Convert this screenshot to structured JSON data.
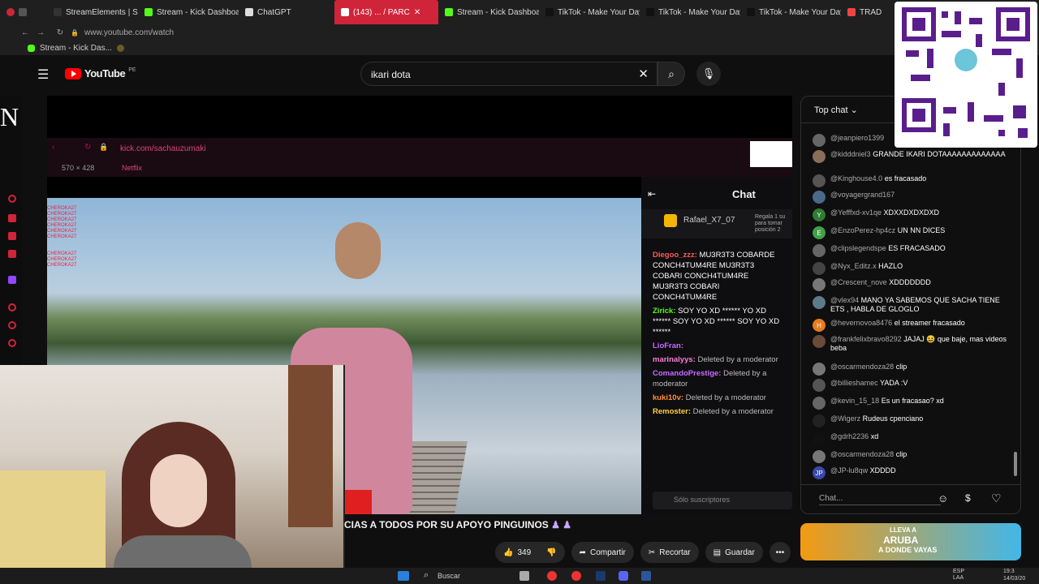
{
  "browser": {
    "tabs": [
      {
        "label": "StreamElements | Subati",
        "color": "#333"
      },
      {
        "label": "Stream - Kick Dashboard",
        "color": "#53fc18"
      },
      {
        "label": "ChatGPT",
        "color": "#ddd"
      },
      {
        "label": "(143) ... / PARC",
        "color": "#fff",
        "active": true
      },
      {
        "label": "Stream - Kick Dashboard",
        "color": "#53fc18"
      },
      {
        "label": "TikTok - Make Your Day",
        "color": "#111"
      },
      {
        "label": "TikTok - Make Your Day",
        "color": "#111"
      },
      {
        "label": "TikTok - Make Your Day",
        "color": "#111"
      },
      {
        "label": "TRADU",
        "color": "#e44"
      }
    ],
    "url": "www.youtube.com/watch",
    "bookmark": "Stream - Kick Das..."
  },
  "youtube": {
    "logo": "YouTube",
    "region": "PE",
    "search_value": "ikari dota",
    "video_title": "CIAS A TODOS POR SU APOYO PINGUINOS",
    "likes": "349",
    "share": "Compartir",
    "clip": "Recortar",
    "save": "Guardar",
    "more": "•••"
  },
  "left_letter": "N",
  "inner_browser": {
    "url": "kick.com/sachauzumaki",
    "size": "570 × 428",
    "bookmark": "Netflix"
  },
  "kick_chat": {
    "title": "Chat",
    "pinned_user": "Rafael_X7_07",
    "pinned_note": "Regala 1 su para tomar posición 2",
    "messages": [
      {
        "user": "Diegoo_zzz:",
        "text": "MU3R3T3 COBARDE CONCH4TUM4RE MU3R3T3 COBARI CONCH4TUM4RE MU3R3T3 COBARI CONCH4TUM4RE",
        "color": "#ff5a5a"
      },
      {
        "user": "Zirick:",
        "text": "SOY YO XD ****** YO XD ****** SOY YO XD ****** SOY YO XD ******",
        "color": "#53fc18"
      },
      {
        "user": "LioFran:",
        "text": "",
        "color": "#c76bff"
      },
      {
        "user": "marinalyys:",
        "text": "Deleted by a moderator",
        "color": "#ff7ad9"
      },
      {
        "user": "ComandoPrestige:",
        "text": "Deleted by a moderator",
        "color": "#c76bff"
      },
      {
        "user": "kuki10v:",
        "text": "Deleted by a moderator",
        "color": "#ff8b3d"
      },
      {
        "user": "Remoster:",
        "text": "Deleted by a moderator",
        "color": "#ffd23f"
      }
    ],
    "input_placeholder": "Sólo suscriptores"
  },
  "yt_chat": {
    "header": "Top chat",
    "input_placeholder": "Chat...",
    "messages": [
      {
        "user": "@jeanpiero1399",
        "text": "",
        "av": "#666",
        "initial": ""
      },
      {
        "user": "@kidddniel3",
        "text": "GRANDE IKARI DOTAAAAAAAAAAAAA",
        "av": "#8a6d5a",
        "initial": ""
      },
      {
        "user": "@Kinghouse4.0",
        "text": "es fracasado",
        "av": "#555",
        "initial": ""
      },
      {
        "user": "@voyagergrand167",
        "text": "",
        "av": "#4a6a8a",
        "initial": ""
      },
      {
        "user": "@Yefffxd-xv1qe",
        "text": "XDXXDXDXDXD",
        "av": "#2e7d32",
        "initial": "Y"
      },
      {
        "user": "@EnzoPerez-hp4cz",
        "text": "UN NN DICES",
        "av": "#43a047",
        "initial": "E"
      },
      {
        "user": "@clipslegendspe",
        "text": "ES FRACASADO",
        "av": "#666",
        "initial": ""
      },
      {
        "user": "@Nyx_Editz.x",
        "text": "HAZLO",
        "av": "#444",
        "initial": ""
      },
      {
        "user": "@Crescent_nove",
        "text": "XDDDDDDD",
        "av": "#777",
        "initial": ""
      },
      {
        "user": "@vlex94",
        "text": "MANO YA SABEMOS QUE SACHA TIENE ETS , HABLA DE GLOGLO",
        "av": "#5d7a8a",
        "initial": ""
      },
      {
        "user": "@hevernovoa8476",
        "text": "el streamer fracasado",
        "av": "#e57c1f",
        "initial": "H"
      },
      {
        "user": "@frankfelixbravo8292",
        "text": "JAJAJ 😆 que baje, mas videos beba",
        "av": "#6a4a3a",
        "initial": ""
      },
      {
        "user": "@oscarmendoza28",
        "text": "clip",
        "av": "#777",
        "initial": ""
      },
      {
        "user": "@billieshamec",
        "text": "YADA :V",
        "av": "#555",
        "initial": ""
      },
      {
        "user": "@kevin_15_18",
        "text": "Es un fracasao? xd",
        "av": "#666",
        "initial": ""
      },
      {
        "user": "@Wigerz",
        "text": "Rudeus cpenciano",
        "av": "#222",
        "initial": ""
      },
      {
        "user": "@gdrh2236",
        "text": "xd",
        "av": "#111",
        "initial": ""
      },
      {
        "user": "@oscarmendoza28",
        "text": "clip",
        "av": "#777",
        "initial": ""
      },
      {
        "user": "@JP-lu8qw",
        "text": "XDDDD",
        "av": "#3949ab",
        "initial": "JP"
      }
    ]
  },
  "ad": {
    "text1": "LLEVA A",
    "text2": "ARUBA",
    "text3": "A DONDE VAYAS"
  },
  "taskbar": {
    "search": "Buscar",
    "lang": "ESP LAA",
    "time": "19:3",
    "date": "14/03/20"
  }
}
